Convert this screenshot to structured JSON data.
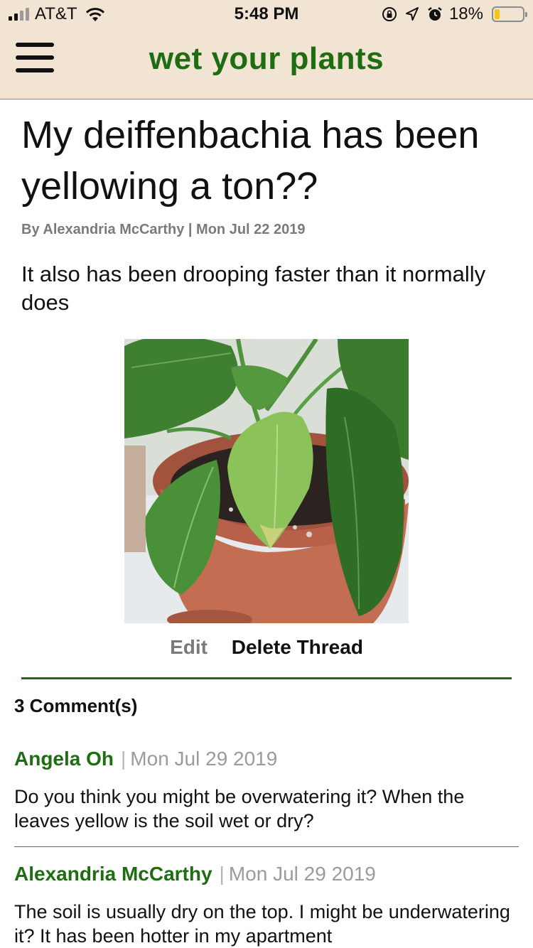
{
  "status_bar": {
    "carrier": "AT&T",
    "time": "5:48 PM",
    "battery": "18%",
    "battery_level": 0.18
  },
  "header": {
    "app_title": "wet your plants"
  },
  "post": {
    "title": "My deiffenbachia has been yellowing a ton??",
    "byline": "By Alexandria McCarthy | Mon Jul 22 2019",
    "body": "It also has been drooping faster than it normally does",
    "edit_label": "Edit",
    "delete_label": "Delete Thread"
  },
  "comments": {
    "count_label": "3 Comment(s)",
    "separator": "|",
    "items": [
      {
        "author": "Angela Oh",
        "date": "Mon Jul 29 2019",
        "text": "Do you think you might be overwatering it? When the leaves yellow is the soil wet or dry?"
      },
      {
        "author": "Alexandria McCarthy",
        "date": "Mon Jul 29 2019",
        "text": "The soil is usually dry on the top. I might be underwatering it? It has been hotter in my apartment"
      }
    ]
  },
  "colors": {
    "header_bg": "#f1e4d3",
    "brand_green": "#1f6d12",
    "muted_gray": "#7a7a7a"
  },
  "icons": [
    "signal-icon",
    "wifi-icon",
    "rotation-lock-icon",
    "location-icon",
    "alarm-icon",
    "battery-icon",
    "hamburger-menu-icon"
  ]
}
